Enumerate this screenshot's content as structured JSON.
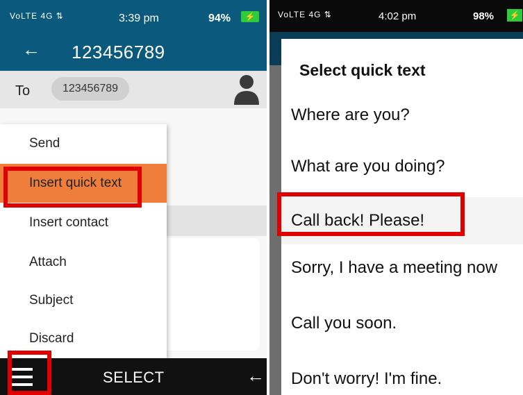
{
  "left": {
    "status": {
      "signal": "VoLTE 4G ⇅",
      "time": "3:39 pm",
      "battery": "94%"
    },
    "appbar": {
      "title": "123456789"
    },
    "to": {
      "label": "To",
      "recipient": "123456789"
    },
    "menu": {
      "items": [
        {
          "label": "Send"
        },
        {
          "label": "Insert quick text",
          "highlighted": true
        },
        {
          "label": "Insert contact"
        },
        {
          "label": "Attach"
        },
        {
          "label": "Subject"
        },
        {
          "label": "Discard"
        }
      ]
    },
    "bottom": {
      "center": "SELECT"
    }
  },
  "right": {
    "status": {
      "signal": "VoLTE 4G ⇅",
      "time": "4:02 pm",
      "battery": "98%"
    },
    "dialog": {
      "title": "Select quick text",
      "options": [
        {
          "label": "Where are you?"
        },
        {
          "label": "What are you doing?"
        },
        {
          "label": "Call back! Please!",
          "selected": true
        },
        {
          "label": "Sorry, I have a meeting now"
        },
        {
          "label": "Call you soon."
        },
        {
          "label": "Don't worry! I'm fine."
        }
      ]
    }
  },
  "colors": {
    "appbar": "#0b5a7e",
    "menu_highlight": "#ef7d3c",
    "annotation": "#e00000",
    "battery": "#2ecc3a"
  }
}
